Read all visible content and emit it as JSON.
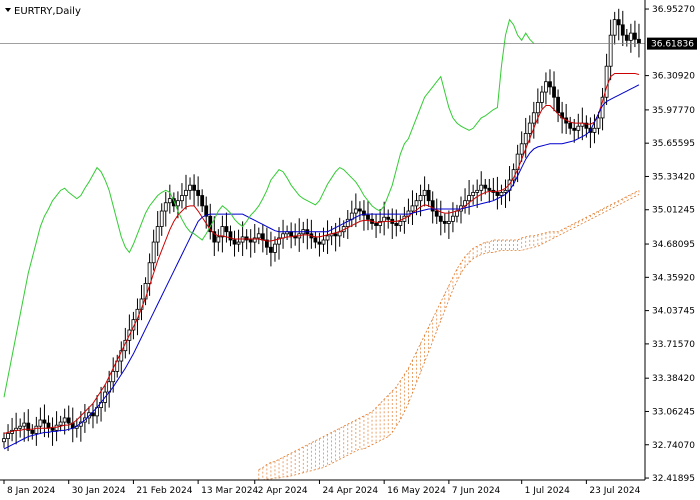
{
  "chart_data": {
    "type": "candlestick",
    "title": "EURTRY,Daily",
    "current_price": "36.61836",
    "ylim": [
      32.4,
      37.04
    ],
    "y_ticks": [
      "36.95270",
      "36.30920",
      "35.97770",
      "35.65595",
      "35.33420",
      "35.01245",
      "34.68095",
      "34.35920",
      "34.03745",
      "33.71570",
      "33.38420",
      "33.06245",
      "32.74070",
      "32.41895"
    ],
    "y_tick_values": [
      36.9527,
      36.3092,
      35.9777,
      35.65595,
      35.3342,
      35.01245,
      34.68095,
      34.3592,
      34.03745,
      33.7157,
      33.3842,
      33.06245,
      32.7407,
      32.41895
    ],
    "x_ticks": [
      "8 Jan 2024",
      "30 Jan 2024",
      "21 Feb 2024",
      "13 Mar 2024",
      "2 Apr 2024",
      "24 Apr 2024",
      "16 May 2024",
      "7 Jun 2024",
      "1 Jul 2024",
      "23 Jul 2024"
    ],
    "x_tick_index": [
      0,
      16,
      32,
      48,
      62,
      78,
      94,
      110,
      128,
      144
    ],
    "bars_count": 158,
    "closes": [
      32.8,
      32.85,
      32.88,
      32.9,
      32.92,
      32.95,
      32.88,
      32.85,
      32.92,
      32.98,
      32.95,
      32.9,
      32.88,
      32.93,
      32.96,
      33.0,
      32.95,
      32.9,
      32.92,
      32.96,
      33.0,
      33.05,
      33.02,
      33.1,
      33.15,
      33.25,
      33.35,
      33.45,
      33.55,
      33.65,
      33.75,
      33.85,
      33.95,
      34.05,
      34.15,
      34.3,
      34.5,
      34.7,
      34.85,
      35.0,
      35.08,
      35.12,
      35.05,
      35.1,
      35.15,
      35.2,
      35.25,
      35.2,
      35.15,
      35.05,
      34.95,
      34.8,
      34.7,
      34.75,
      34.85,
      34.8,
      34.72,
      34.68,
      34.7,
      34.75,
      34.72,
      34.7,
      34.74,
      34.78,
      34.72,
      34.65,
      34.6,
      34.68,
      34.74,
      34.78,
      34.8,
      34.76,
      34.74,
      34.78,
      34.82,
      34.78,
      34.74,
      34.7,
      34.68,
      34.72,
      34.76,
      34.78,
      34.76,
      34.8,
      34.85,
      34.92,
      34.98,
      35.02,
      35.0,
      34.96,
      34.92,
      34.88,
      34.86,
      34.9,
      34.94,
      34.92,
      34.88,
      34.86,
      34.9,
      34.95,
      35.0,
      35.05,
      35.1,
      35.15,
      35.2,
      35.1,
      35.0,
      34.95,
      34.9,
      34.88,
      34.9,
      34.95,
      35.0,
      35.05,
      35.1,
      35.15,
      35.18,
      35.2,
      35.25,
      35.22,
      35.2,
      35.18,
      35.15,
      35.18,
      35.2,
      35.3,
      35.4,
      35.55,
      35.65,
      35.75,
      35.85,
      35.95,
      36.05,
      36.15,
      36.25,
      36.2,
      36.1,
      35.95,
      35.9,
      35.85,
      35.8,
      35.78,
      35.82,
      35.85,
      35.8,
      35.76,
      35.8,
      35.9,
      36.1,
      36.4,
      36.7,
      36.85,
      36.8,
      36.7,
      36.65,
      36.72,
      36.66,
      36.62
    ],
    "tenkan": [
      32.85,
      32.86,
      32.87,
      32.88,
      32.88,
      32.89,
      32.89,
      32.89,
      32.9,
      32.9,
      32.9,
      32.9,
      32.91,
      32.91,
      32.92,
      32.93,
      32.93,
      32.95,
      32.98,
      33.02,
      33.06,
      33.1,
      33.14,
      33.2,
      33.26,
      33.32,
      33.4,
      33.48,
      33.56,
      33.64,
      33.72,
      33.8,
      33.88,
      33.96,
      34.06,
      34.16,
      34.28,
      34.4,
      34.52,
      34.62,
      34.72,
      34.82,
      34.9,
      34.96,
      35.0,
      35.04,
      35.05,
      35.05,
      35.0,
      34.94,
      34.88,
      34.82,
      34.78,
      34.76,
      34.76,
      34.75,
      34.74,
      34.73,
      34.73,
      34.73,
      34.73,
      34.73,
      34.73,
      34.73,
      34.72,
      34.71,
      34.71,
      34.72,
      34.73,
      34.74,
      34.75,
      34.75,
      34.76,
      34.76,
      34.77,
      34.77,
      34.76,
      34.75,
      34.75,
      34.76,
      34.77,
      34.78,
      34.79,
      34.8,
      34.82,
      34.84,
      34.86,
      34.88,
      34.9,
      34.91,
      34.91,
      34.9,
      34.89,
      34.89,
      34.9,
      34.9,
      34.9,
      34.9,
      34.91,
      34.93,
      34.95,
      34.98,
      35.01,
      35.04,
      35.06,
      35.05,
      35.03,
      35.01,
      34.99,
      34.98,
      34.98,
      34.99,
      35.0,
      35.02,
      35.05,
      35.08,
      35.11,
      35.14,
      35.16,
      35.18,
      35.19,
      35.19,
      35.19,
      35.2,
      35.22,
      35.26,
      35.32,
      35.4,
      35.5,
      35.6,
      35.7,
      35.8,
      35.9,
      35.98,
      36.02,
      36.02,
      35.98,
      35.94,
      35.9,
      35.88,
      35.86,
      35.85,
      35.85,
      35.85,
      35.84,
      35.84,
      35.86,
      35.94,
      36.06,
      36.2,
      36.3,
      36.33,
      36.33,
      36.33,
      36.33,
      36.33,
      36.33,
      36.32
    ],
    "kijun": [
      32.7,
      32.72,
      32.74,
      32.76,
      32.78,
      32.8,
      32.82,
      32.83,
      32.84,
      32.85,
      32.86,
      32.86,
      32.87,
      32.87,
      32.88,
      32.88,
      32.89,
      32.9,
      32.92,
      32.95,
      32.98,
      33.02,
      33.06,
      33.1,
      33.15,
      33.2,
      33.25,
      33.3,
      33.36,
      33.42,
      33.48,
      33.55,
      33.62,
      33.7,
      33.78,
      33.86,
      33.94,
      34.02,
      34.1,
      34.18,
      34.26,
      34.34,
      34.42,
      34.5,
      34.58,
      34.66,
      34.74,
      34.82,
      34.9,
      34.94,
      34.96,
      34.97,
      34.97,
      34.97,
      34.97,
      34.97,
      34.97,
      34.97,
      34.97,
      34.97,
      34.95,
      34.93,
      34.91,
      34.89,
      34.87,
      34.85,
      34.83,
      34.81,
      34.8,
      34.8,
      34.8,
      34.8,
      34.8,
      34.8,
      34.8,
      34.8,
      34.8,
      34.8,
      34.8,
      34.8,
      34.8,
      34.82,
      34.84,
      34.86,
      34.88,
      34.9,
      34.92,
      34.94,
      34.96,
      34.97,
      34.97,
      34.97,
      34.97,
      34.97,
      34.97,
      34.97,
      34.97,
      34.97,
      34.97,
      34.97,
      34.97,
      34.98,
      34.99,
      35.0,
      35.01,
      35.02,
      35.02,
      35.02,
      35.02,
      35.02,
      35.02,
      35.02,
      35.02,
      35.02,
      35.03,
      35.04,
      35.05,
      35.06,
      35.07,
      35.08,
      35.09,
      35.1,
      35.12,
      35.14,
      35.16,
      35.2,
      35.26,
      35.34,
      35.42,
      35.5,
      35.56,
      35.6,
      35.62,
      35.63,
      35.64,
      35.65,
      35.65,
      35.65,
      35.65,
      35.66,
      35.67,
      35.68,
      35.7,
      35.72,
      35.74,
      35.78,
      35.86,
      35.94,
      36.02,
      36.06,
      36.08,
      36.1,
      36.12,
      36.14,
      36.16,
      36.18,
      36.2,
      36.22
    ],
    "chikou": [
      33.2,
      33.4,
      33.6,
      33.8,
      34.0,
      34.2,
      34.4,
      34.55,
      34.7,
      34.85,
      34.95,
      35.02,
      35.1,
      35.15,
      35.2,
      35.22,
      35.18,
      35.15,
      35.12,
      35.15,
      35.22,
      35.28,
      35.35,
      35.42,
      35.38,
      35.3,
      35.2,
      35.05,
      34.9,
      34.75,
      34.65,
      34.6,
      34.68,
      34.78,
      34.88,
      34.98,
      35.05,
      35.1,
      35.15,
      35.18,
      35.2,
      35.18,
      35.1,
      35.0,
      34.92,
      34.85,
      34.8,
      34.78,
      34.75,
      34.72,
      34.78,
      34.85,
      34.92,
      35.0,
      35.05,
      35.02,
      34.98,
      34.92,
      34.88,
      34.85,
      34.9,
      34.96,
      35.0,
      35.05,
      35.12,
      35.2,
      35.3,
      35.35,
      35.4,
      35.38,
      35.32,
      35.25,
      35.2,
      35.15,
      35.12,
      35.1,
      35.08,
      35.06,
      35.1,
      35.18,
      35.26,
      35.32,
      35.38,
      35.42,
      35.4,
      35.36,
      35.32,
      35.28,
      35.22,
      35.15,
      35.1,
      35.05,
      35.02,
      35.0,
      35.05,
      35.15,
      35.25,
      35.4,
      35.55,
      35.65,
      35.7,
      35.8,
      35.9,
      36.0,
      36.1,
      36.15,
      36.2,
      36.25,
      36.3,
      36.15,
      36.0,
      35.9,
      35.85,
      35.82,
      35.8,
      35.78,
      35.8,
      35.85,
      35.9,
      35.92,
      35.95,
      35.98,
      36.0,
      36.4,
      36.7,
      36.85,
      36.8,
      36.7,
      36.65,
      36.72,
      36.66,
      36.62
    ],
    "senkou_a": [
      32.5,
      32.52,
      32.55,
      32.57,
      32.58,
      32.6,
      32.62,
      32.64,
      32.66,
      32.68,
      32.7,
      32.72,
      32.74,
      32.76,
      32.78,
      32.8,
      32.82,
      32.84,
      32.86,
      32.88,
      32.9,
      32.92,
      32.94,
      32.96,
      32.98,
      33.0,
      33.02,
      33.04,
      33.06,
      33.1,
      33.14,
      33.18,
      33.22,
      33.26,
      33.3,
      33.36,
      33.42,
      33.48,
      33.56,
      33.64,
      33.72,
      33.8,
      33.88,
      33.96,
      34.04,
      34.12,
      34.2,
      34.28,
      34.36,
      34.44,
      34.5,
      34.56,
      34.6,
      34.64,
      34.66,
      34.68,
      34.7,
      34.7,
      34.72,
      34.72,
      34.72,
      34.72,
      34.72,
      34.72,
      34.72,
      34.74,
      34.75,
      34.76,
      34.76,
      34.77,
      34.78,
      34.79,
      34.8,
      34.8,
      34.8,
      34.82,
      34.84,
      34.86,
      34.88,
      34.9,
      34.92,
      34.94,
      34.96,
      34.98,
      35.0,
      35.02,
      35.04,
      35.06,
      35.08,
      35.1,
      35.12,
      35.14,
      35.16,
      35.18,
      35.2
    ],
    "senkou_b": [
      32.4,
      32.4,
      32.41,
      32.41,
      32.42,
      32.42,
      32.43,
      32.43,
      32.44,
      32.45,
      32.46,
      32.47,
      32.48,
      32.49,
      32.5,
      32.51,
      32.52,
      32.54,
      32.56,
      32.58,
      32.6,
      32.62,
      32.64,
      32.66,
      32.68,
      32.7,
      32.7,
      32.72,
      32.74,
      32.76,
      32.78,
      32.8,
      32.82,
      32.86,
      32.92,
      32.98,
      33.06,
      33.14,
      33.24,
      33.34,
      33.44,
      33.54,
      33.64,
      33.74,
      33.84,
      33.94,
      34.04,
      34.14,
      34.24,
      34.32,
      34.4,
      34.46,
      34.5,
      34.54,
      34.56,
      34.58,
      34.59,
      34.6,
      34.6,
      34.61,
      34.62,
      34.62,
      34.62,
      34.62,
      34.62,
      34.62,
      34.63,
      34.64,
      34.65,
      34.66,
      34.68,
      34.7,
      34.72,
      34.74,
      34.76,
      34.78,
      34.8,
      34.82,
      34.84,
      34.86,
      34.88,
      34.9,
      34.92,
      34.94,
      34.96,
      34.98,
      35.0,
      35.02,
      35.04,
      35.06,
      35.08,
      35.1,
      35.12,
      35.14,
      35.16
    ]
  },
  "colors": {
    "background": "#ffffff",
    "candle_bull": "#000000",
    "candle_bear": "#000000",
    "tenkan": "#cc0000",
    "kijun": "#0000cc",
    "chikou": "#33cc33",
    "kumo": "#e07828",
    "price_line": "#808080",
    "price_tag_bg": "#000000"
  }
}
